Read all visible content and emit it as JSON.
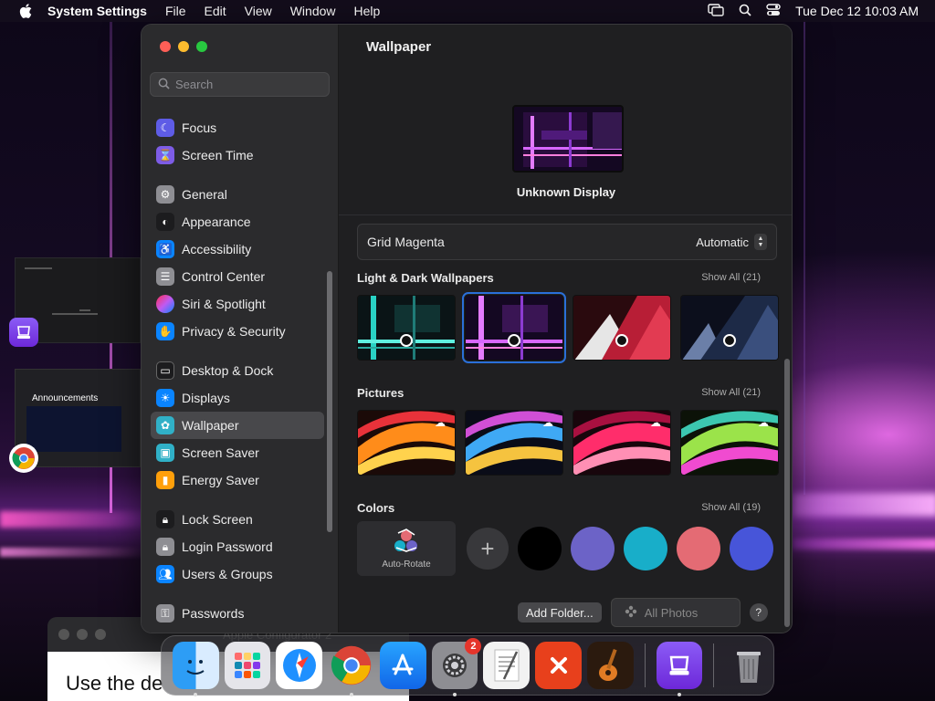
{
  "menubar": {
    "app_name": "System Settings",
    "menus": [
      "File",
      "Edit",
      "View",
      "Window",
      "Help"
    ],
    "clock": "Tue Dec 12  10:03 AM"
  },
  "background_window": {
    "thumb_label": "Announcements",
    "content_text": "Use the de",
    "title_text": "Apple Configurator 2"
  },
  "sidebar": {
    "search_placeholder": "Search",
    "items": [
      {
        "label": "Focus",
        "icon": "moon-icon",
        "color": "#5e5ce6"
      },
      {
        "label": "Screen Time",
        "icon": "hourglass-icon",
        "color": "#7d5ce6"
      },
      {
        "label": "General",
        "icon": "gear-icon",
        "color": "#8e8e93"
      },
      {
        "label": "Appearance",
        "icon": "appearance-icon",
        "color": "#1c1c1e"
      },
      {
        "label": "Accessibility",
        "icon": "accessibility-icon",
        "color": "#0a84ff"
      },
      {
        "label": "Control Center",
        "icon": "control-center-icon",
        "color": "#8e8e93"
      },
      {
        "label": "Siri & Spotlight",
        "icon": "siri-icon",
        "color": "#bf5af2"
      },
      {
        "label": "Privacy & Security",
        "icon": "hand-icon",
        "color": "#0a84ff"
      },
      {
        "label": "Desktop & Dock",
        "icon": "dock-icon",
        "color": "#1c1c1e"
      },
      {
        "label": "Displays",
        "icon": "sun-icon",
        "color": "#0a84ff"
      },
      {
        "label": "Wallpaper",
        "icon": "flower-icon",
        "color": "#30b0c7"
      },
      {
        "label": "Screen Saver",
        "icon": "screen-saver-icon",
        "color": "#30b0c7"
      },
      {
        "label": "Energy Saver",
        "icon": "battery-icon",
        "color": "#ff9f0a"
      },
      {
        "label": "Lock Screen",
        "icon": "lock-icon",
        "color": "#1c1c1e"
      },
      {
        "label": "Login Password",
        "icon": "padlock-icon",
        "color": "#8e8e93"
      },
      {
        "label": "Users & Groups",
        "icon": "users-icon",
        "color": "#0a84ff"
      },
      {
        "label": "Passwords",
        "icon": "key-icon",
        "color": "#8e8e93"
      }
    ],
    "active": "Wallpaper"
  },
  "main": {
    "title": "Wallpaper",
    "display_name": "Unknown Display",
    "wallpaper_name": "Grid Magenta",
    "wallpaper_mode": "Automatic",
    "sections": {
      "light_dark": {
        "title": "Light & Dark Wallpapers",
        "show_all": "Show All (21)"
      },
      "pictures": {
        "title": "Pictures",
        "show_all": "Show All (21)"
      },
      "colors": {
        "title": "Colors",
        "show_all": "Show All (19)"
      }
    },
    "auto_rotate_label": "Auto-Rotate",
    "color_swatches": [
      "#000000",
      "#6c63c7",
      "#18aec9",
      "#e46b74",
      "#4755d9"
    ],
    "add_folder_label": "Add Folder...",
    "all_photos_label": "All Photos",
    "help_label": "?"
  },
  "dock": {
    "apps": [
      "Finder",
      "Launchpad",
      "Safari",
      "Chrome",
      "App Store",
      "System Settings",
      "TextEdit",
      "Remote Desktop",
      "GarageBand",
      "Apple Configurator",
      "Trash"
    ],
    "settings_badge": "2"
  },
  "colors": {
    "accent": "#2a6fd8",
    "close": "#ff5f57",
    "minimize": "#febc2e",
    "zoom": "#28c840"
  }
}
